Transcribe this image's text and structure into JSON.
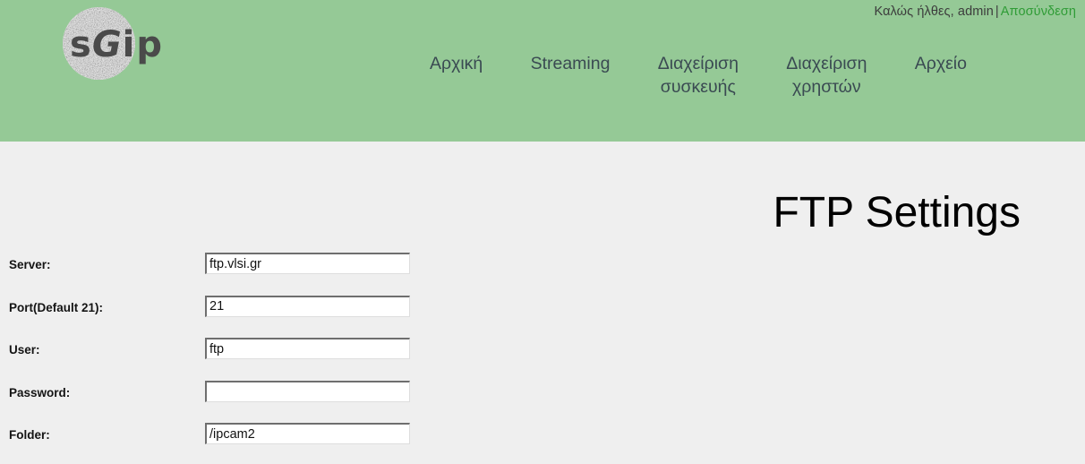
{
  "header": {
    "welcome_text": "Καλώς ήλθες, admin",
    "separator": "|",
    "logout_label": "Αποσύνδεση",
    "logout_color": "#2f9c36",
    "background_color": "#95c996",
    "logo": {
      "text_s": "s",
      "text_g": "G",
      "text_ip": "ip",
      "alt": "sGip logo"
    },
    "nav": [
      {
        "label": "Αρχική"
      },
      {
        "label": "Streaming"
      },
      {
        "label": "Διαχείριση\nσυσκευής"
      },
      {
        "label": "Διαχείριση\nχρηστών"
      },
      {
        "label": "Αρχείο"
      }
    ]
  },
  "main": {
    "title": "FTP Settings",
    "background_color": "#efefef",
    "fields": [
      {
        "label": "Server:",
        "value": "ftp.vlsi.gr",
        "type": "text",
        "name": "server"
      },
      {
        "label": "Port(Default 21):",
        "value": "21",
        "type": "text",
        "name": "port"
      },
      {
        "label": "User:",
        "value": "ftp",
        "type": "text",
        "name": "user"
      },
      {
        "label": "Password:",
        "value": "",
        "type": "password",
        "name": "password"
      },
      {
        "label": "Folder:",
        "value": "/ipcam2",
        "type": "text",
        "name": "folder"
      }
    ]
  }
}
